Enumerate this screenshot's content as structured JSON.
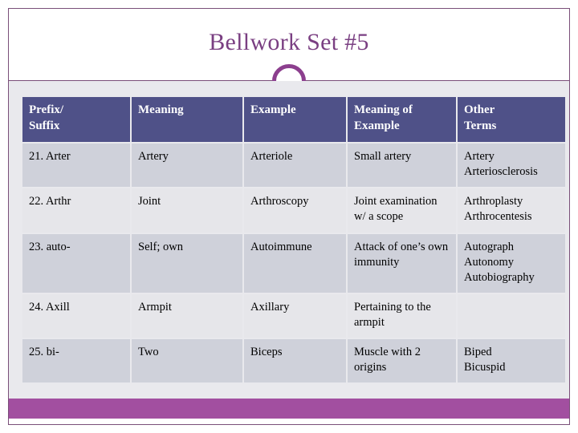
{
  "slide": {
    "title": "Bellwork Set #5",
    "accent_color": "#7a3f82",
    "header_color": "#4f5188",
    "bottom_bar_color": "#a24fa0",
    "row_color": "#cfd1da",
    "row_alt_color": "#e6e6ea",
    "decor": {
      "ring": "circle-outline-decoration",
      "rule": "horizontal-rule-decoration"
    }
  },
  "table": {
    "headers": [
      "Prefix/ Suffix",
      "Meaning",
      "Example",
      "Meaning of Example",
      "Other Terms"
    ],
    "header_lines": [
      [
        "Prefix/",
        "Suffix"
      ],
      [
        "Meaning"
      ],
      [
        "Example"
      ],
      [
        "Meaning of",
        "Example"
      ],
      [
        "Other",
        "Terms"
      ]
    ],
    "rows": [
      {
        "prefix_suffix": "21. Arter",
        "meaning": "Artery",
        "example": "Arteriole",
        "meaning_of_example": "Small artery",
        "other_terms": [
          "Artery",
          "Arteriosclerosis"
        ]
      },
      {
        "prefix_suffix": "22. Arthr",
        "meaning": "Joint",
        "example": "Arthroscopy",
        "meaning_of_example": "Joint examination w/ a scope",
        "other_terms": [
          "Arthroplasty",
          "Arthrocentesis"
        ]
      },
      {
        "prefix_suffix": "23. auto-",
        "meaning": "Self; own",
        "example": "Autoimmune",
        "meaning_of_example": "Attack of one’s own immunity",
        "other_terms": [
          "Autograph",
          "Autonomy",
          "Autobiography"
        ]
      },
      {
        "prefix_suffix": "24. Axill",
        "meaning": "Armpit",
        "example": "Axillary",
        "meaning_of_example": "Pertaining to the armpit",
        "other_terms": []
      },
      {
        "prefix_suffix": "25. bi-",
        "meaning": "Two",
        "example": "Biceps",
        "meaning_of_example": "Muscle with 2 origins",
        "other_terms": [
          "Biped",
          "Bicuspid"
        ]
      }
    ]
  }
}
